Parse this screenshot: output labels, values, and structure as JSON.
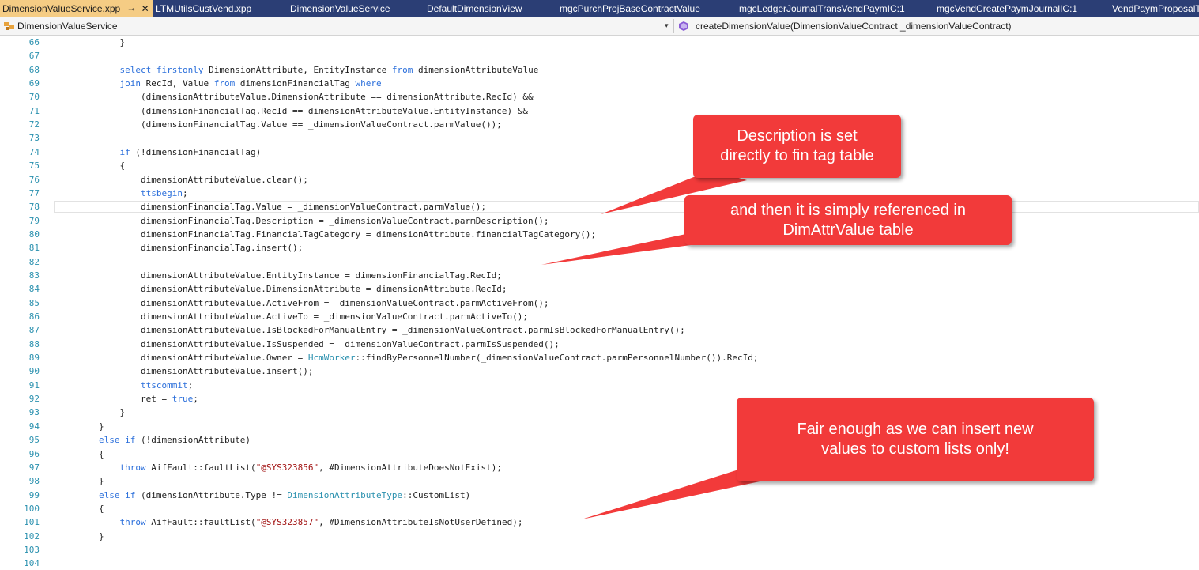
{
  "tabs": [
    {
      "label": "DimensionValueService.xpp",
      "active": true,
      "pin": "⊸",
      "close": "✕"
    },
    {
      "label": "LTMUtilsCustVend.xpp",
      "active": false
    },
    {
      "label": "DimensionValueService",
      "active": false
    },
    {
      "label": "DefaultDimensionView",
      "active": false
    },
    {
      "label": "mgcPurchProjBaseContractValue",
      "active": false
    },
    {
      "label": "mgcLedgerJournalTransVendPaymIC:1",
      "active": false
    },
    {
      "label": "mgcVendCreatePaymJournalIC:1",
      "active": false
    },
    {
      "label": "VendPaymProposalTra",
      "active": false
    }
  ],
  "navbar": {
    "class_label": "DimensionValueService",
    "method_label": "createDimensionValue(DimensionValueContract _dimensionValueContract)",
    "dropdown_glyph": "▾"
  },
  "lines": [
    {
      "n": "66",
      "code": "            }"
    },
    {
      "n": "67",
      "code": ""
    },
    {
      "n": "68",
      "code": "            select firstonly DimensionAttribute, EntityInstance from dimensionAttributeValue"
    },
    {
      "n": "69",
      "code": "            join RecId, Value from dimensionFinancialTag where"
    },
    {
      "n": "70",
      "code": "                (dimensionAttributeValue.DimensionAttribute == dimensionAttribute.RecId) &&"
    },
    {
      "n": "71",
      "code": "                (dimensionFinancialTag.RecId == dimensionAttributeValue.EntityInstance) &&"
    },
    {
      "n": "72",
      "code": "                (dimensionFinancialTag.Value == _dimensionValueContract.parmValue());"
    },
    {
      "n": "73",
      "code": ""
    },
    {
      "n": "74",
      "code": "            if (!dimensionFinancialTag)"
    },
    {
      "n": "75",
      "code": "            {"
    },
    {
      "n": "76",
      "code": "                dimensionAttributeValue.clear();"
    },
    {
      "n": "77",
      "code": "                ttsbegin;"
    },
    {
      "n": "78",
      "code": "                dimensionFinancialTag.Value = _dimensionValueContract.parmValue();"
    },
    {
      "n": "79",
      "code": "                dimensionFinancialTag.Description = _dimensionValueContract.parmDescription();"
    },
    {
      "n": "80",
      "code": "                dimensionFinancialTag.FinancialTagCategory = dimensionAttribute.financialTagCategory();"
    },
    {
      "n": "81",
      "code": "                dimensionFinancialTag.insert();"
    },
    {
      "n": "82",
      "code": ""
    },
    {
      "n": "83",
      "code": "                dimensionAttributeValue.EntityInstance = dimensionFinancialTag.RecId;"
    },
    {
      "n": "84",
      "code": "                dimensionAttributeValue.DimensionAttribute = dimensionAttribute.RecId;"
    },
    {
      "n": "85",
      "code": "                dimensionAttributeValue.ActiveFrom = _dimensionValueContract.parmActiveFrom();"
    },
    {
      "n": "86",
      "code": "                dimensionAttributeValue.ActiveTo = _dimensionValueContract.parmActiveTo();"
    },
    {
      "n": "87",
      "code": "                dimensionAttributeValue.IsBlockedForManualEntry = _dimensionValueContract.parmIsBlockedForManualEntry();"
    },
    {
      "n": "88",
      "code": "                dimensionAttributeValue.IsSuspended = _dimensionValueContract.parmIsSuspended();"
    },
    {
      "n": "89",
      "code": "                dimensionAttributeValue.Owner = HcmWorker::findByPersonnelNumber(_dimensionValueContract.parmPersonnelNumber()).RecId;"
    },
    {
      "n": "90",
      "code": "                dimensionAttributeValue.insert();"
    },
    {
      "n": "91",
      "code": "                ttscommit;"
    },
    {
      "n": "92",
      "code": "                ret = true;"
    },
    {
      "n": "93",
      "code": "            }"
    },
    {
      "n": "94",
      "code": "        }"
    },
    {
      "n": "95",
      "code": "        else if (!dimensionAttribute)"
    },
    {
      "n": "96",
      "code": "        {"
    },
    {
      "n": "97",
      "code": "            throw AifFault::faultList(\"@SYS323856\", #DimensionAttributeDoesNotExist);"
    },
    {
      "n": "98",
      "code": "        }"
    },
    {
      "n": "99",
      "code": "        else if (dimensionAttribute.Type != DimensionAttributeType::CustomList)"
    },
    {
      "n": "100",
      "code": "        {"
    },
    {
      "n": "101",
      "code": "            throw AifFault::faultList(\"@SYS323857\", #DimensionAttributeIsNotUserDefined);"
    },
    {
      "n": "102",
      "code": "        }"
    },
    {
      "n": "103",
      "code": ""
    },
    {
      "n": "104",
      "code": ""
    }
  ],
  "current_line": "78",
  "callouts": [
    {
      "line1": "Description is set",
      "line2": "directly to fin tag table"
    },
    {
      "line1": "and then it is simply referenced in",
      "line2": "DimAttrValue table"
    },
    {
      "line1": "Fair enough as we can insert new",
      "line2": "values to custom lists only!"
    }
  ],
  "colors": {
    "tabbar_bg": "#2b3e75",
    "active_tab_bg": "#f5cc84",
    "line_number": "#2b91af",
    "keyword": "#2b6fdb",
    "string": "#a31515",
    "type": "#2b91af",
    "callout_bg": "#f23a3a"
  }
}
